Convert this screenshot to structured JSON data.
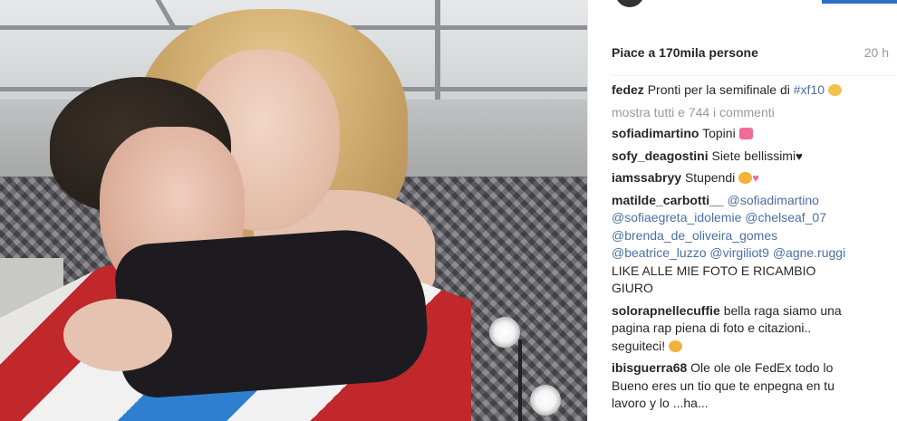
{
  "post": {
    "likes_text": "Piace a 170mila persone",
    "time_text": "20 h",
    "caption": {
      "user": "fedez",
      "text": "Pronti per la semifinale di",
      "hashtag": "#xf10"
    },
    "show_all_comments": "mostra tutti e 744 i commenti",
    "comments": [
      {
        "user": "sofiadimartino",
        "text": "Topini"
      },
      {
        "user": "sofy_deagostini",
        "text": "Siete bellissimi"
      },
      {
        "user": "iamssabryy",
        "text": "Stupendi"
      },
      {
        "user": "matilde_carbotti__",
        "mention1": "@sofiadimartino",
        "line2": "@sofiaegreta_idolemie @chelseaf_07",
        "line3": "@brenda_de_oliveira_gomes",
        "line4": "@beatrice_luzzo @virgiliot9 @agne.ruggi",
        "line5": "LIKE ALLE MIE FOTO E RICAMBIO",
        "line6": "GIURO"
      },
      {
        "user": "solorapnellecuffie",
        "text1": "bella raga siamo una",
        "line2": "pagina rap piena di foto e citazioni..",
        "line3": "seguiteci!"
      },
      {
        "user": "ibisguerra68",
        "text1": "Ole ole ole FedEx todo lo",
        "line2": "Bueno eres un tio que te enpegna en tu",
        "line3": "lavoro y lo ...ha..."
      }
    ]
  },
  "colors": {
    "accent_blue": "#2f6ec1",
    "text": "#262626",
    "muted": "#999999",
    "mention": "#4a6fa5"
  },
  "icons": {
    "caption_emoji": "grin-sweat-emoji",
    "c1_emoji": "heart-ribbon-emoji",
    "c2_emoji": "black-heart-emoji",
    "c3_emoji": "heart-eyes-emoji",
    "c5_emoji": "pray-emoji"
  }
}
